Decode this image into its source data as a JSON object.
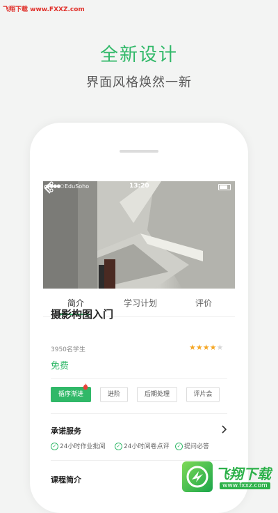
{
  "watermark": {
    "top_text": "飞翔下载 www.FXXZ.com"
  },
  "hero": {
    "title": "全新设计",
    "subtitle": "界面风格焕然一新"
  },
  "statusbar": {
    "signal": "●●●●○",
    "carrier": "EduSoho",
    "time": "13:20"
  },
  "tabs": [
    {
      "label": "简介",
      "active": true
    },
    {
      "label": "学习计划",
      "active": false
    },
    {
      "label": "评价",
      "active": false
    }
  ],
  "course": {
    "title": "摄影构图入门",
    "students": "3950名学生",
    "rating": 4,
    "rating_max": 5,
    "price": "免费"
  },
  "tags": [
    {
      "label": "循序渐进",
      "active": true
    },
    {
      "label": "进阶",
      "active": false
    },
    {
      "label": "后期处理",
      "active": false
    },
    {
      "label": "评片会",
      "active": false
    }
  ],
  "promise": {
    "title": "承诺服务",
    "items": [
      "24小时作业批阅",
      "24小时阅卷点评",
      "提问必答"
    ]
  },
  "intro": {
    "title": "课程简介"
  },
  "bottom_logo": {
    "text": "飞翔下载",
    "url": "www.fxxz.com"
  },
  "colors": {
    "accent": "#30b868",
    "star": "#f5a623",
    "background": "#f3f4f3"
  }
}
